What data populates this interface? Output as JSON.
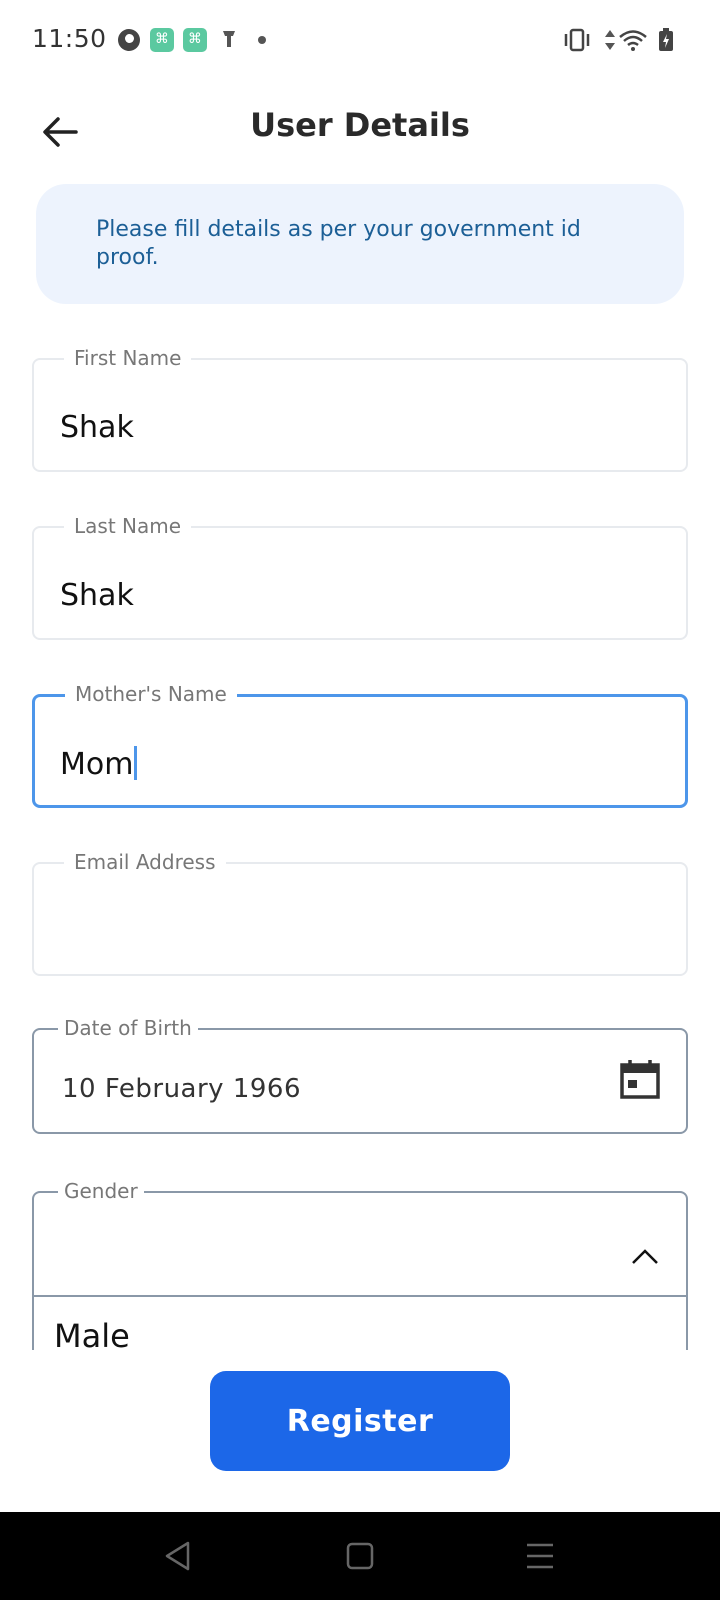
{
  "status_bar": {
    "time": "11:50",
    "icons": [
      "pinwheel-icon",
      "app-notification-icon",
      "app-notification-icon",
      "vpn-key-icon",
      "more-dot-icon",
      "vibrate-icon",
      "data-arrows-icon",
      "wifi-icon",
      "battery-charging-icon"
    ]
  },
  "header": {
    "title": "User Details",
    "back_icon": "arrow-left-icon"
  },
  "info_banner": {
    "text": "Please fill details as per your government id proof."
  },
  "form": {
    "first_name": {
      "label": "First Name",
      "value": "Shak"
    },
    "last_name": {
      "label": "Last Name",
      "value": "Shak"
    },
    "mothers_name": {
      "label": "Mother's Name",
      "value": "Mom"
    },
    "email": {
      "label": "Email Address",
      "value": ""
    },
    "dob": {
      "label": "Date of Birth",
      "value": "10 February 1966",
      "icon": "calendar-icon"
    },
    "gender": {
      "label": "Gender",
      "value": "",
      "options": [
        "Male"
      ],
      "icon": "chevron-up-icon"
    }
  },
  "register_button": {
    "label": "Register"
  },
  "colors": {
    "accent": "#1c67e8",
    "focus": "#4d96ea",
    "banner_bg": "#edf3fd",
    "banner_text": "#1c5f96"
  },
  "nav_bar": {
    "icons": [
      "back-triangle-icon",
      "home-square-icon",
      "menu-lines-icon"
    ]
  }
}
